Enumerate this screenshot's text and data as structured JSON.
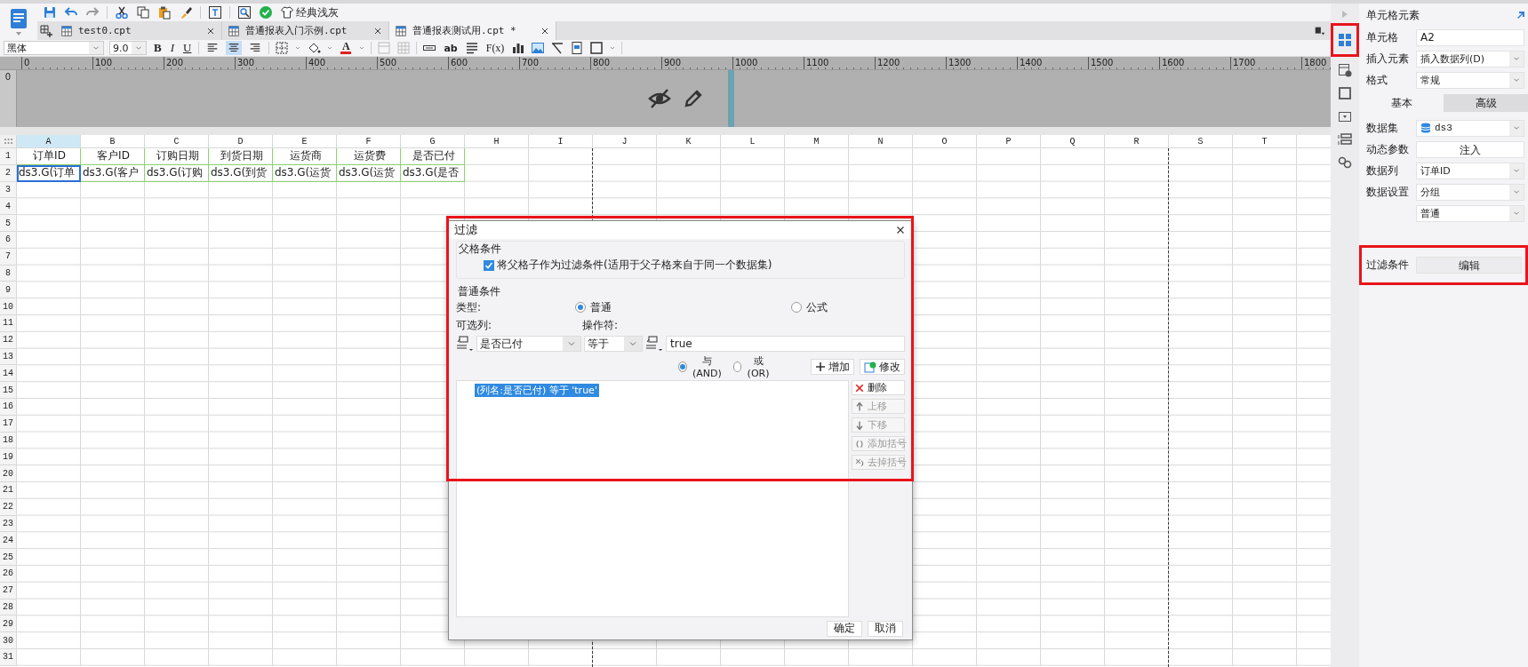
{
  "quick_toolbar": {
    "theme_label": "经典浅灰"
  },
  "tabs": [
    {
      "label": "test0.cpt",
      "selected": false
    },
    {
      "label": "普通报表入门示例.cpt",
      "selected": false
    },
    {
      "label": "普通报表测试用.cpt *",
      "selected": true
    }
  ],
  "format_bar": {
    "font": "黑体",
    "font_size": "9.0",
    "bold_label": "B",
    "italic_label": "I",
    "underline_label": "U",
    "font_color_label": "A",
    "text_label": "ab",
    "formula_label": "F(x)",
    "align_buttons": [
      {
        "selected": false
      },
      {
        "selected": true
      },
      {
        "selected": false
      }
    ]
  },
  "ruler": {
    "vertical_tick": "0",
    "ticks": [
      "0",
      "100",
      "200",
      "300",
      "400",
      "500",
      "600",
      "700",
      "800",
      "900",
      "1000",
      "1100",
      "1200",
      "1300",
      "1400",
      "1500",
      "1600",
      "1700",
      "1800"
    ]
  },
  "sheet": {
    "columns": [
      {
        "label": "A",
        "selected": true,
        "page_break": false
      },
      {
        "label": "B",
        "selected": false,
        "page_break": false
      },
      {
        "label": "C",
        "selected": false,
        "page_break": false
      },
      {
        "label": "D",
        "selected": false,
        "page_break": false
      },
      {
        "label": "E",
        "selected": false,
        "page_break": false
      },
      {
        "label": "F",
        "selected": false,
        "page_break": false
      },
      {
        "label": "G",
        "selected": false,
        "page_break": false
      },
      {
        "label": "H",
        "selected": false,
        "page_break": false
      },
      {
        "label": "I",
        "selected": false,
        "page_break": true
      },
      {
        "label": "J",
        "selected": false,
        "page_break": false
      },
      {
        "label": "K",
        "selected": false,
        "page_break": false
      },
      {
        "label": "L",
        "selected": false,
        "page_break": false
      },
      {
        "label": "M",
        "selected": false,
        "page_break": false
      },
      {
        "label": "N",
        "selected": false,
        "page_break": false
      },
      {
        "label": "O",
        "selected": false,
        "page_break": false
      },
      {
        "label": "P",
        "selected": false,
        "page_break": false
      },
      {
        "label": "Q",
        "selected": false,
        "page_break": false
      },
      {
        "label": "R",
        "selected": false,
        "page_break": true
      },
      {
        "label": "S",
        "selected": false,
        "page_break": false
      },
      {
        "label": "T",
        "selected": false,
        "page_break": false
      }
    ],
    "rows": [
      {
        "label": "1",
        "cells": [
          {
            "text": "订单ID",
            "selected": false
          },
          {
            "text": "客户ID",
            "selected": false
          },
          {
            "text": "订购日期",
            "selected": false
          },
          {
            "text": "到货日期",
            "selected": false
          },
          {
            "text": "运货商",
            "selected": false
          },
          {
            "text": "运货费",
            "selected": false
          },
          {
            "text": "是否已付",
            "selected": false
          }
        ]
      },
      {
        "label": "2",
        "cells": [
          {
            "text": "ds3.G(订单",
            "selected": true
          },
          {
            "text": "ds3.G(客户",
            "selected": false
          },
          {
            "text": "ds3.G(订购",
            "selected": false
          },
          {
            "text": "ds3.G(到货",
            "selected": false
          },
          {
            "text": "ds3.G(运货",
            "selected": false
          },
          {
            "text": "ds3.G(运货",
            "selected": false
          },
          {
            "text": "ds3.G(是否",
            "selected": false
          }
        ]
      },
      {
        "label": "3"
      },
      {
        "label": "4"
      },
      {
        "label": "5"
      },
      {
        "label": "6"
      },
      {
        "label": "7"
      },
      {
        "label": "8"
      },
      {
        "label": "9"
      },
      {
        "label": "10"
      },
      {
        "label": "11"
      },
      {
        "label": "12"
      },
      {
        "label": "13"
      },
      {
        "label": "14"
      },
      {
        "label": "15"
      },
      {
        "label": "16"
      },
      {
        "label": "17"
      },
      {
        "label": "18"
      },
      {
        "label": "19"
      },
      {
        "label": "20"
      },
      {
        "label": "21"
      },
      {
        "label": "22"
      },
      {
        "label": "23"
      },
      {
        "label": "24"
      },
      {
        "label": "25"
      },
      {
        "label": "26"
      },
      {
        "label": "27"
      },
      {
        "label": "28"
      },
      {
        "label": "29"
      },
      {
        "label": "30"
      },
      {
        "label": "31"
      }
    ]
  },
  "dialog": {
    "title": "过滤",
    "parent_group": {
      "title": "父格条件",
      "checkbox_label": "将父格子作为过滤条件(适用于父子格来自于同一个数据集)",
      "checked": true
    },
    "normal_group": {
      "title": "普通条件",
      "type_label": "类型:",
      "type_options": [
        {
          "label": "普通",
          "selected": true
        },
        {
          "label": "公式",
          "selected": false
        }
      ],
      "column_label": "可选列:",
      "operator_label": "操作符:",
      "column_value": "是否已付",
      "operator_value": "等于",
      "value": "true",
      "joins": [
        {
          "label": "与(AND)",
          "selected": true
        },
        {
          "label": "或(OR)",
          "selected": false
        }
      ],
      "add_button": "增加",
      "modify_button": "修改",
      "conditions": [
        {
          "text": "(列名:是否已付) 等于 'true'",
          "selected": true
        }
      ],
      "side_buttons": [
        {
          "label": "删除",
          "disabled": false
        },
        {
          "label": "上移",
          "disabled": true
        },
        {
          "label": "下移",
          "disabled": true
        },
        {
          "label": "添加括号",
          "disabled": true
        },
        {
          "label": "去掉括号",
          "disabled": true
        }
      ]
    },
    "buttons": [
      "确定",
      "取消"
    ]
  },
  "tool_strip": [
    {
      "selected": true
    },
    {
      "selected": false
    },
    {
      "selected": false
    },
    {
      "selected": false
    },
    {
      "selected": false
    },
    {
      "selected": false
    }
  ],
  "side_panel": {
    "title": "单元格元素",
    "fields": [
      {
        "kind": "input",
        "label": "单元格",
        "value": "A2"
      },
      {
        "kind": "select",
        "label": "插入元素",
        "value": "插入数据列(D)"
      },
      {
        "kind": "select",
        "label": "格式",
        "value": "常规"
      }
    ],
    "tabs": [
      {
        "label": "基本",
        "selected": true
      },
      {
        "label": "高级",
        "selected": false
      }
    ],
    "settings": [
      {
        "kind": "dataset",
        "label": "数据集",
        "value": "ds3"
      },
      {
        "kind": "button",
        "label": "动态参数",
        "value": "注入"
      },
      {
        "kind": "select",
        "label": "数据列",
        "value": "订单ID"
      },
      {
        "kind": "select",
        "label": "数据设置",
        "value": "分组"
      },
      {
        "kind": "select",
        "value": "普通"
      }
    ],
    "filter_row": {
      "label": "过滤条件",
      "button": "编辑"
    }
  }
}
